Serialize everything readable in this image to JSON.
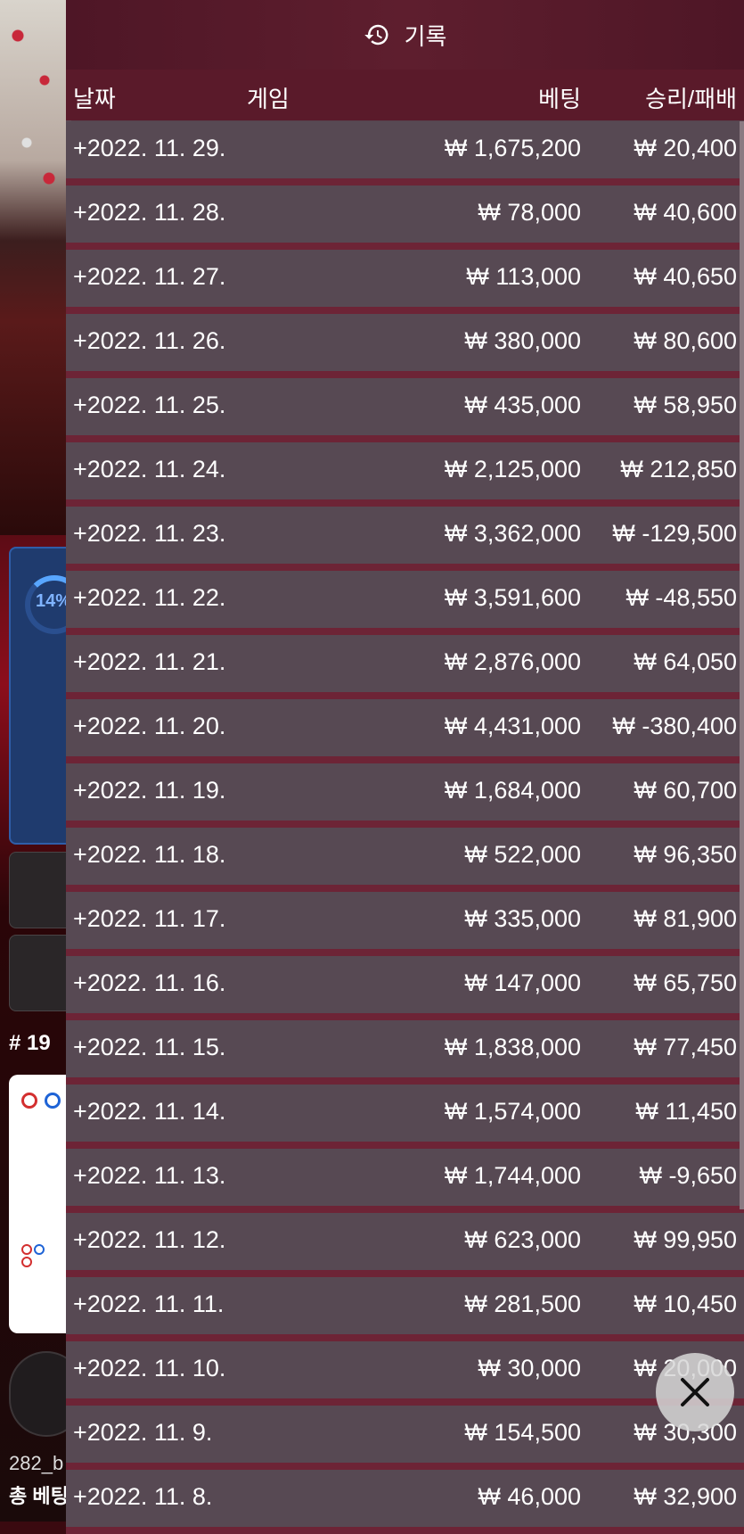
{
  "background": {
    "progress_text": "14%",
    "round_number": "# 19",
    "username": "282_b",
    "total_bet_label": "총 베팅"
  },
  "panel": {
    "title": "기록",
    "icon": "history-icon",
    "columns": {
      "date": "날짜",
      "game": "게임",
      "bet": "베팅",
      "winloss": "승리/패배"
    },
    "rows": [
      {
        "date": "+2022. 11. 29.",
        "bet": "₩ 1,675,200",
        "winloss": "₩ 20,400"
      },
      {
        "date": "+2022. 11. 28.",
        "bet": "₩ 78,000",
        "winloss": "₩ 40,600"
      },
      {
        "date": "+2022. 11. 27.",
        "bet": "₩ 113,000",
        "winloss": "₩ 40,650"
      },
      {
        "date": "+2022. 11. 26.",
        "bet": "₩ 380,000",
        "winloss": "₩ 80,600"
      },
      {
        "date": "+2022. 11. 25.",
        "bet": "₩ 435,000",
        "winloss": "₩ 58,950"
      },
      {
        "date": "+2022. 11. 24.",
        "bet": "₩ 2,125,000",
        "winloss": "₩ 212,850"
      },
      {
        "date": "+2022. 11. 23.",
        "bet": "₩ 3,362,000",
        "winloss": "₩ -129,500"
      },
      {
        "date": "+2022. 11. 22.",
        "bet": "₩ 3,591,600",
        "winloss": "₩ -48,550"
      },
      {
        "date": "+2022. 11. 21.",
        "bet": "₩ 2,876,000",
        "winloss": "₩ 64,050"
      },
      {
        "date": "+2022. 11. 20.",
        "bet": "₩ 4,431,000",
        "winloss": "₩ -380,400"
      },
      {
        "date": "+2022. 11. 19.",
        "bet": "₩ 1,684,000",
        "winloss": "₩ 60,700"
      },
      {
        "date": "+2022. 11. 18.",
        "bet": "₩ 522,000",
        "winloss": "₩ 96,350"
      },
      {
        "date": "+2022. 11. 17.",
        "bet": "₩ 335,000",
        "winloss": "₩ 81,900"
      },
      {
        "date": "+2022. 11. 16.",
        "bet": "₩ 147,000",
        "winloss": "₩ 65,750"
      },
      {
        "date": "+2022. 11. 15.",
        "bet": "₩ 1,838,000",
        "winloss": "₩ 77,450"
      },
      {
        "date": "+2022. 11. 14.",
        "bet": "₩ 1,574,000",
        "winloss": "₩ 11,450"
      },
      {
        "date": "+2022. 11. 13.",
        "bet": "₩ 1,744,000",
        "winloss": "₩ -9,650"
      },
      {
        "date": "+2022. 11. 12.",
        "bet": "₩ 623,000",
        "winloss": "₩ 99,950"
      },
      {
        "date": "+2022. 11. 11.",
        "bet": "₩ 281,500",
        "winloss": "₩ 10,450"
      },
      {
        "date": "+2022. 11. 10.",
        "bet": "₩ 30,000",
        "winloss": "₩ 20,000"
      },
      {
        "date": "+2022. 11. 9.",
        "bet": "₩ 154,500",
        "winloss": "₩ 30,300"
      },
      {
        "date": "+2022. 11. 8.",
        "bet": "₩ 46,000",
        "winloss": "₩ 32,900"
      }
    ],
    "close_icon": "close-icon"
  }
}
